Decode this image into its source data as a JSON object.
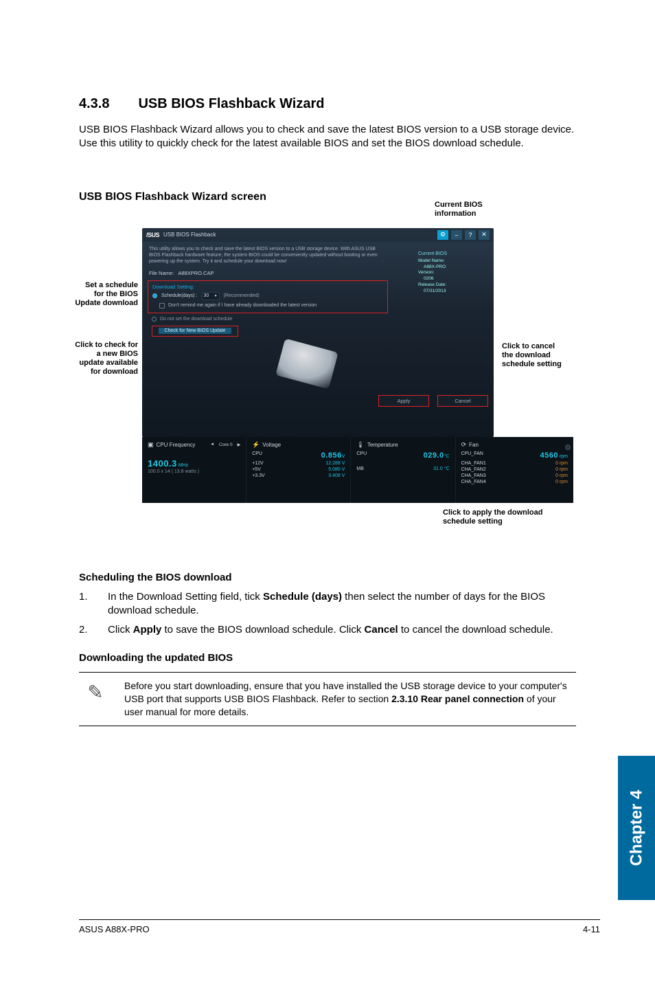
{
  "section": {
    "number": "4.3.8",
    "title": "USB BIOS Flashback Wizard"
  },
  "intro": "USB BIOS Flashback Wizard allows you to check and save the latest BIOS version to a USB storage device. Use this utility to quickly check for the latest available BIOS and set the BIOS download schedule.",
  "fig_heading": "USB BIOS Flashback Wizard screen",
  "callouts": {
    "top_right": "Current BIOS information",
    "left1": "Set a schedule for the BIOS Update download",
    "left2": "Click to check for a new BIOS update available for download",
    "right1": "Click to cancel the download schedule setting",
    "bottom": "Click to apply the download schedule setting"
  },
  "app": {
    "logo": "/SUS",
    "title": "USB BIOS Flashback",
    "desc": "This utility allows you to check and save the latest BIOS version to a USB storage device. With ASUS USB BIOS Flashback hardware feature, the system BIOS could be conveniently updated without booting or even powering up the system. Try it and schedule your download now!",
    "file_label": "File Name:",
    "file_name": "A88XPRO.CAP",
    "ds_heading": "Download Setting:",
    "sched_label": "Schedule(days) :",
    "sched_value": "30",
    "sched_rec": "(Recommended)",
    "remind_label": "Don't remind me again if I have already downloaded the latest version",
    "noset_label": "Do not set the download schedule",
    "check_btn": "Check for New BIOS Update",
    "apply": "Apply",
    "cancel": "Cancel",
    "bios": {
      "hdr": "Current BIOS",
      "model_k": "Model Name:",
      "model_v": "A88X-PRO",
      "ver_k": "Version:",
      "ver_v": "0206",
      "rel_k": "Release Date:",
      "rel_v": "07/31/2013"
    }
  },
  "monitor": {
    "cpu_freq": {
      "label": "CPU Frequency",
      "core": "Core 0",
      "val": "1400.3",
      "unit": "MHz",
      "sub": "100.0 x 14 ( 13.8  watts )"
    },
    "voltage": {
      "label": "Voltage",
      "rows": [
        {
          "k": "CPU",
          "v": "0.856",
          "u": "V",
          "big": true
        },
        {
          "k": "+12V",
          "v": "12.288 V"
        },
        {
          "k": "+5V",
          "v": "5.080 V"
        },
        {
          "k": "+3.3V",
          "v": "3.408 V"
        }
      ]
    },
    "temp": {
      "label": "Temperature",
      "rows": [
        {
          "k": "CPU",
          "v": "029.0",
          "u": "°C",
          "big": true
        },
        {
          "k": "MB",
          "v": "31.0 °C"
        }
      ]
    },
    "fan": {
      "label": "Fan",
      "rows": [
        {
          "k": "CPU_FAN",
          "v": "4560",
          "u": "rpm",
          "big": true
        },
        {
          "k": "CHA_FAN1",
          "v": "0 rpm"
        },
        {
          "k": "CHA_FAN2",
          "v": "0 rpm"
        },
        {
          "k": "CHA_FAN3",
          "v": "0 rpm"
        },
        {
          "k": "CHA_FAN4",
          "v": "0 rpm"
        }
      ]
    }
  },
  "instr": {
    "h1": "Scheduling the BIOS download",
    "i1_pre": "In the Download Setting field, tick ",
    "i1_b": "Schedule (days)",
    "i1_post": " then select the number of days for the BIOS download schedule.",
    "i2_pre": "Click ",
    "i2_b1": "Apply",
    "i2_mid": " to save the BIOS download schedule. Click ",
    "i2_b2": "Cancel",
    "i2_post": " to cancel the download schedule.",
    "h2": "Downloading the updated BIOS",
    "note_pre": "Before you start downloading, ensure that you have installed the USB storage device to your computer's USB port that supports USB BIOS Flashback. Refer to section ",
    "note_b": "2.3.10 Rear panel connection",
    "note_post": " of your user manual for more details."
  },
  "side_tab": "Chapter 4",
  "footer": {
    "left": "ASUS A88X-PRO",
    "right": "4-11"
  },
  "nums": {
    "one": "1.",
    "two": "2."
  },
  "icons": {
    "arrow_l": "◄",
    "arrow_r": "▶",
    "tri": "▼",
    "min": "–",
    "help": "?",
    "close": "✕",
    "gear": "⚙",
    "bolt": "⚡",
    "therm": "🌡",
    "fan": "⟳",
    "cpu": "▣",
    "pen": "✎"
  }
}
